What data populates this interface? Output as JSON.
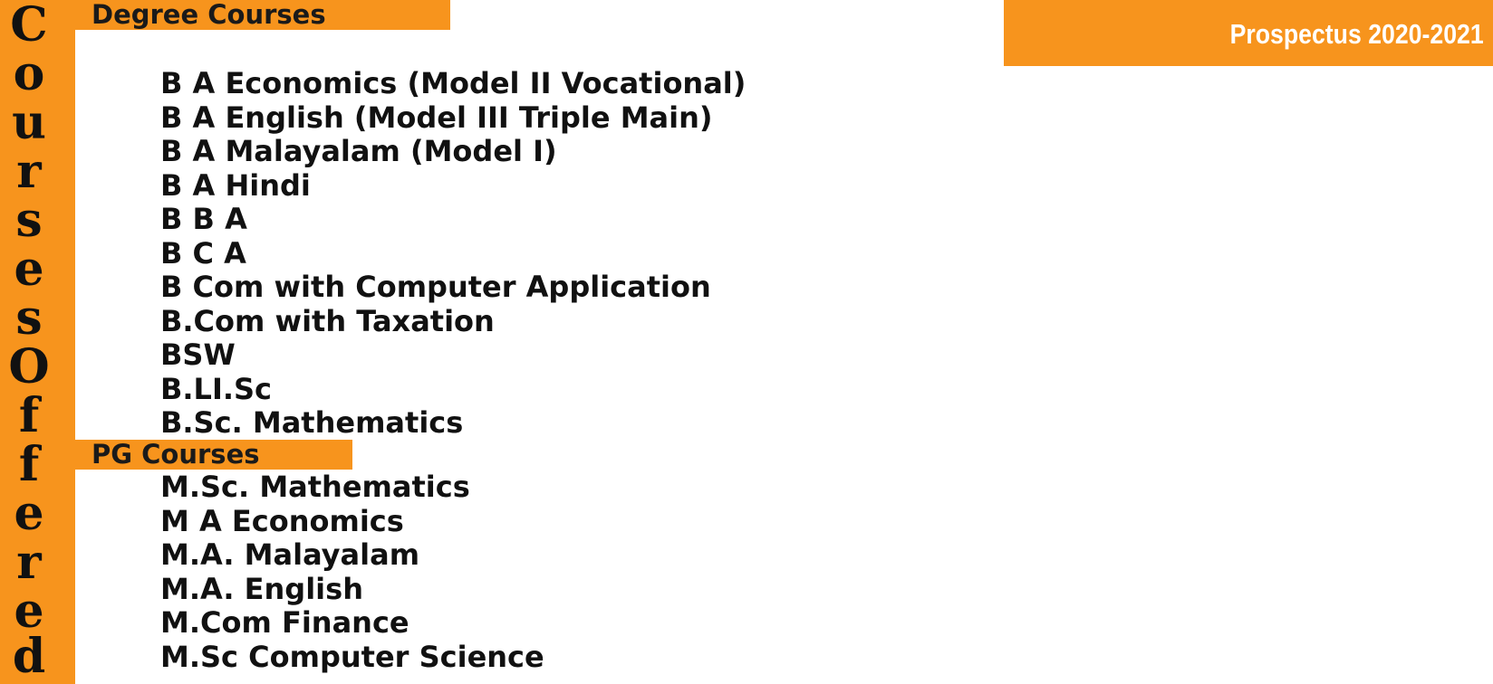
{
  "side_title": "Courses Offered",
  "side_letters": [
    "C",
    "o",
    "u",
    "r",
    "s",
    "e",
    "s",
    "O",
    "f",
    "f",
    "e",
    "r",
    "e",
    "d"
  ],
  "header": {
    "prospectus": "Prospectus 2020-2021"
  },
  "colors": {
    "accent": "#f7941d",
    "text": "#111111",
    "header_text": "#ffffff"
  },
  "sections": {
    "degree": {
      "title": "Degree Courses",
      "courses": [
        "B A Economics (Model II Vocational)",
        "B A English (Model III Triple Main)",
        "B A Malayalam (Model I)",
        "B A Hindi",
        "B B A",
        "B C A",
        "B Com with Computer Application",
        "B.Com with Taxation",
        "BSW",
        "B.LI.Sc",
        "B.Sc. Mathematics"
      ]
    },
    "pg": {
      "title": "PG Courses",
      "courses": [
        "M.Sc. Mathematics",
        "M A Economics",
        "M.A. Malayalam",
        "M.A. English",
        "M.Com Finance",
        "M.Sc Computer Science"
      ]
    }
  }
}
